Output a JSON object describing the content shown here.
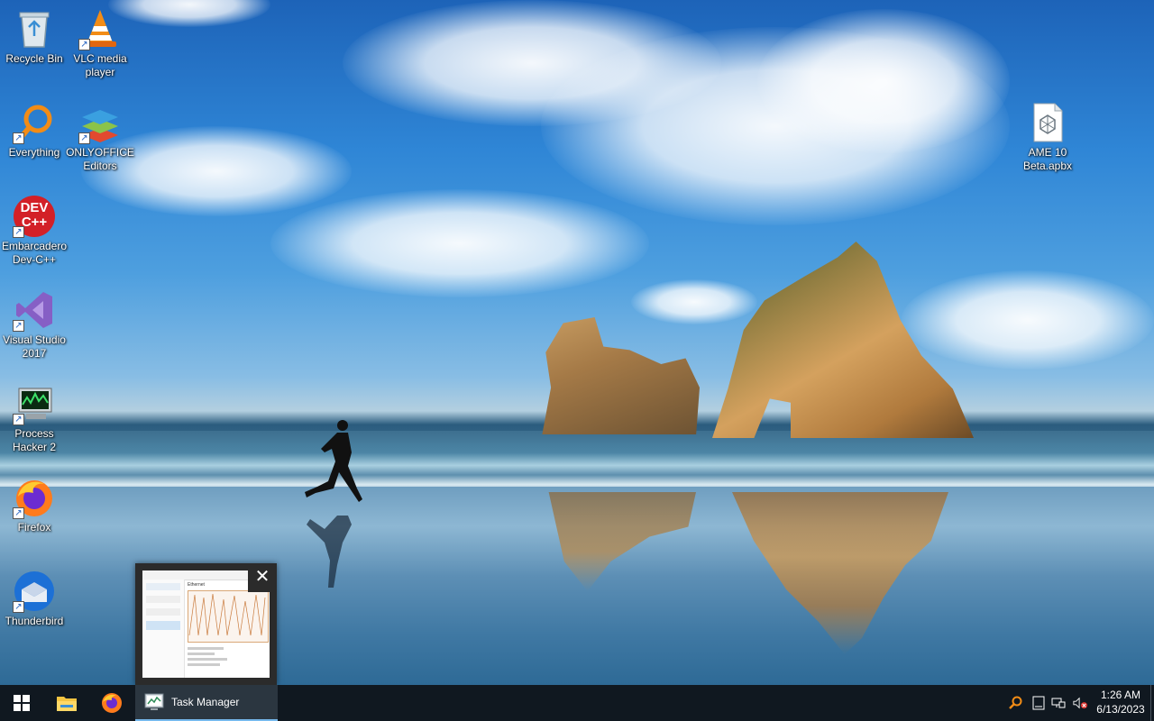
{
  "desktop": {
    "icons": [
      {
        "label": "Recycle Bin",
        "icon": "recycle-bin-icon"
      },
      {
        "label": "VLC media\nplayer",
        "icon": "vlc-icon"
      },
      {
        "label": "Everything",
        "icon": "everything-search-icon"
      },
      {
        "label": "ONLYOFFICE\nEditors",
        "icon": "onlyoffice-icon"
      },
      {
        "label": "Embarcadero\nDev-C++",
        "icon": "devcpp-icon"
      },
      {
        "label": "Visual Studio\n2017",
        "icon": "visual-studio-icon"
      },
      {
        "label": "Process\nHacker 2",
        "icon": "process-hacker-icon"
      },
      {
        "label": "Firefox",
        "icon": "firefox-icon"
      },
      {
        "label": "Thunderbird",
        "icon": "thunderbird-icon"
      },
      {
        "label": "AME 10\nBeta.apbx",
        "icon": "apbx-file-icon"
      }
    ],
    "devcpp_badge": "DEV\nC++"
  },
  "thumbnail": {
    "close_glyph": "✕",
    "panel_title": "Ethernet"
  },
  "taskbar": {
    "start_icon": "windows-start-icon",
    "pinned": [
      "file-explorer-icon",
      "firefox-icon"
    ],
    "active_window_label": "Task Manager",
    "tray_icons": [
      "everything-search-icon",
      "keyboard-icon",
      "network-icon",
      "volume-muted-icon"
    ],
    "time": "1:26 AM",
    "date": "6/13/2023"
  },
  "colors": {
    "taskbar_bg": "#101820",
    "active_task_bg": "#2b3640",
    "active_underline": "#76b9ed"
  }
}
